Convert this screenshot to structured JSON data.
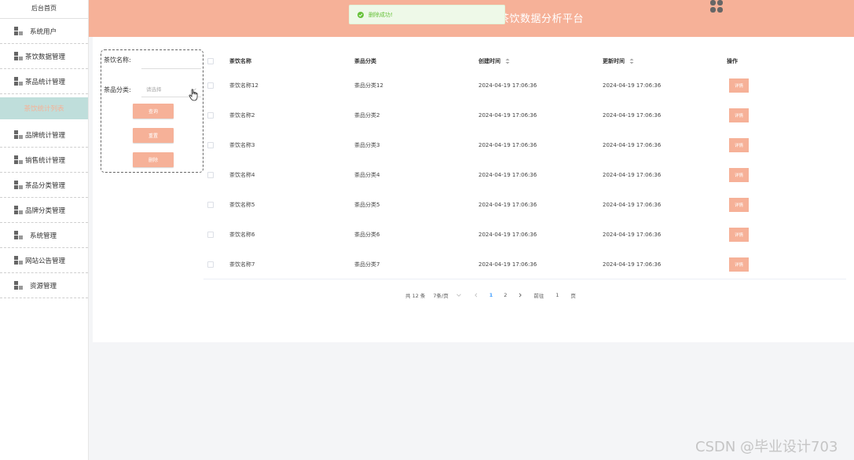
{
  "sidebar": {
    "home": "后台首页",
    "items": [
      {
        "label": "系统用户",
        "icon": "users-icon",
        "compact": false
      },
      {
        "label": "茶饮数据管理",
        "icon": "tea-data-icon",
        "compact": true
      },
      {
        "label": "茶品统计管理",
        "icon": "tea-stats-icon",
        "compact": true
      },
      {
        "label": "茶饮统计列表",
        "icon": "",
        "active": true
      },
      {
        "label": "品牌统计管理",
        "icon": "brand-stats-icon",
        "compact": true
      },
      {
        "label": "销售统计管理",
        "icon": "sales-stats-icon",
        "compact": true
      },
      {
        "label": "茶品分类管理",
        "icon": "tea-category-icon",
        "compact": true
      },
      {
        "label": "品牌分类管理",
        "icon": "brand-category-icon",
        "compact": true
      },
      {
        "label": "系统管理",
        "icon": "system-icon",
        "compact": false
      },
      {
        "label": "网站公告管理",
        "icon": "notice-icon",
        "compact": true
      },
      {
        "label": "资源管理",
        "icon": "resource-icon",
        "compact": false
      }
    ]
  },
  "header": {
    "title": "茶饮数据分析平台",
    "bg_color": "#f6b198",
    "user_icon": "avatar-grid-icon"
  },
  "toast": {
    "message": "删除成功!",
    "icon": "check-circle-icon",
    "color": "#67c23a"
  },
  "search": {
    "name_label": "茶饮名称:",
    "name_value": "",
    "category_label": "茶品分类:",
    "category_placeholder": "请选择",
    "query_button": "查询",
    "reset_button": "重置",
    "delete_button": "删除"
  },
  "table": {
    "headers": {
      "name": "茶饮名称",
      "category": "茶品分类",
      "created": "创建时间",
      "updated": "更新时间",
      "operation": "操作"
    },
    "detail_label": "详情",
    "rows": [
      {
        "name": "茶饮名称12",
        "category": "茶品分类12",
        "created": "2024-04-19 17:06:36",
        "updated": "2024-04-19 17:06:36"
      },
      {
        "name": "茶饮名称2",
        "category": "茶品分类2",
        "created": "2024-04-19 17:06:36",
        "updated": "2024-04-19 17:06:36"
      },
      {
        "name": "茶饮名称3",
        "category": "茶品分类3",
        "created": "2024-04-19 17:06:36",
        "updated": "2024-04-19 17:06:36"
      },
      {
        "name": "茶饮名称4",
        "category": "茶品分类4",
        "created": "2024-04-19 17:06:36",
        "updated": "2024-04-19 17:06:36"
      },
      {
        "name": "茶饮名称5",
        "category": "茶品分类5",
        "created": "2024-04-19 17:06:36",
        "updated": "2024-04-19 17:06:36"
      },
      {
        "name": "茶饮名称6",
        "category": "茶品分类6",
        "created": "2024-04-19 17:06:36",
        "updated": "2024-04-19 17:06:36"
      },
      {
        "name": "茶饮名称7",
        "category": "茶品分类7",
        "created": "2024-04-19 17:06:36",
        "updated": "2024-04-19 17:06:36"
      }
    ]
  },
  "pagination": {
    "total": "共 12 条",
    "page_size": "7条/页",
    "pages": [
      "1",
      "2"
    ],
    "current_page": "1",
    "goto_label": "前往",
    "goto_value": "1",
    "page_suffix": "页"
  },
  "watermark": "CSDN @毕业设计703"
}
